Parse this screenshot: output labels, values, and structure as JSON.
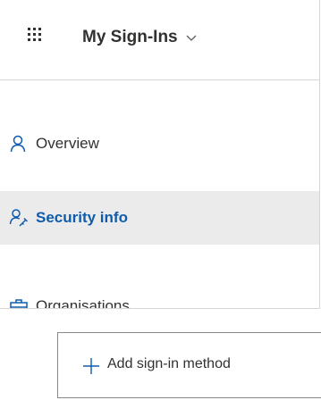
{
  "header": {
    "app_title": "My Sign-Ins",
    "launcher_icon": "waffle-icon",
    "dropdown_icon": "chevron-down-icon"
  },
  "nav": {
    "items": [
      {
        "label": "Overview",
        "icon": "person-icon",
        "active": false
      },
      {
        "label": "Security info",
        "icon": "person-key-icon",
        "active": true
      },
      {
        "label": "Organisations",
        "icon": "briefcase-icon",
        "active": false
      }
    ]
  },
  "actions": {
    "add_method_label": "Add sign-in method",
    "add_icon": "plus-icon"
  },
  "colors": {
    "accent": "#0f5cad",
    "active_background": "#ebebeb",
    "text": "#323130",
    "border": "#d6d6d6"
  }
}
